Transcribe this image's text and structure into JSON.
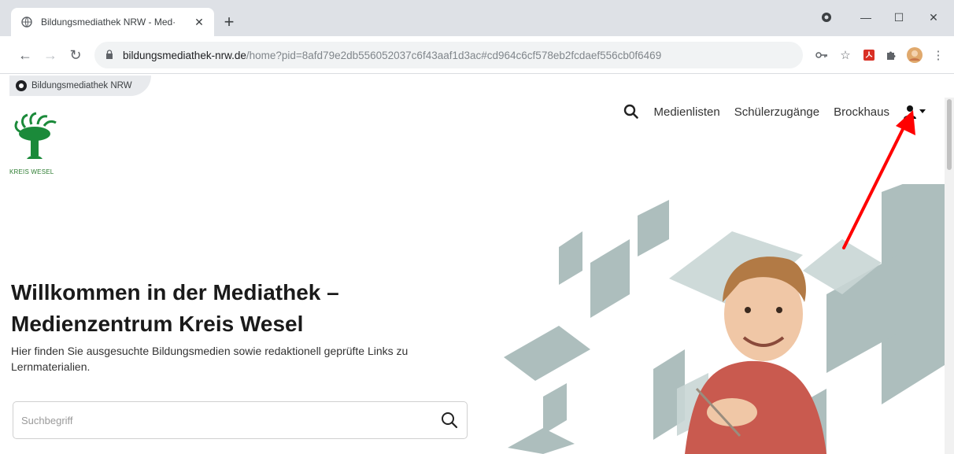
{
  "browser": {
    "tab_title": "Bildungsmediathek NRW - Med·",
    "url_domain": "bildungsmediathek-nrw.de",
    "url_path": "/home?pid=8afd79e2db556052037c6f43aaf1d3ac#cd964c6cf578eb2fcdaef556cb0f6469",
    "bookmark_label": "Bildungsmediathek NRW"
  },
  "site": {
    "logo_text": "KREIS WESEL",
    "nav": {
      "medienlisten": "Medienlisten",
      "schuelerzugaenge": "Schülerzugänge",
      "brockhaus": "Brockhaus"
    },
    "hero_title_line1": "Willkommen in der Mediathek –",
    "hero_title_line2": "Medienzentrum Kreis Wesel",
    "hero_subtitle": "Hier finden Sie ausgesuchte Bildungsmedien sowie redaktionell geprüfte Links zu Lernmaterialien.",
    "search_placeholder": "Suchbegriff"
  },
  "colors": {
    "annotation_arrow": "#ff0000",
    "logo_green": "#1b8a3a",
    "art_gray": "#9fb3b2"
  }
}
